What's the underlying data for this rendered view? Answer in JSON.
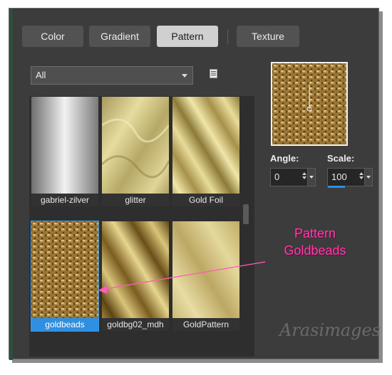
{
  "tabs": [
    {
      "label": "Color",
      "active": false
    },
    {
      "label": "Gradient",
      "active": false
    },
    {
      "label": "Pattern",
      "active": true
    },
    {
      "label": "Texture",
      "active": false
    }
  ],
  "category_select": {
    "value": "All",
    "icon": "chevron-down-icon"
  },
  "library_icon": "document-list-icon",
  "patterns": [
    {
      "label": "gabriel-zilver",
      "selected": false
    },
    {
      "label": "glitter",
      "selected": false
    },
    {
      "label": "Gold Foil",
      "selected": false
    },
    {
      "label": "goldbeads",
      "selected": true
    },
    {
      "label": "goldbg02_mdh",
      "selected": false
    },
    {
      "label": "GoldPattern",
      "selected": false
    }
  ],
  "preview": {
    "icon": "angle-indicator-icon"
  },
  "angle": {
    "label": "Angle:",
    "value": "0"
  },
  "scale": {
    "label": "Scale:",
    "value": "100"
  },
  "annotation": {
    "line1": "Pattern",
    "line2": "Goldbeads",
    "color": "#ff3ca8"
  },
  "signature": "Arasimages"
}
